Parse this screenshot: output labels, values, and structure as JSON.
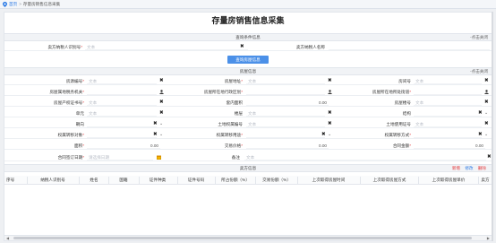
{
  "breadcrumb": {
    "home": "首页",
    "separator": ">",
    "current": "存量房销售信息采集"
  },
  "page_title": "存量房销售信息采集",
  "query_section": {
    "title": "查询条件信息",
    "collapse": "-点击关闭",
    "seller_id_label": "卖方纳税人识别号",
    "seller_id_placeholder": "文本",
    "seller_name_label": "卖方纳税人名称",
    "query_button": "查询房屋信息"
  },
  "house_section": {
    "title": "房屋信息",
    "collapse": "-点击关闭",
    "text_placeholder": "文本",
    "date_placeholder": "请选择日期",
    "rows": [
      [
        {
          "label": "房源编号",
          "required": true,
          "value": "文本",
          "suffix": "x"
        },
        {
          "label": "房屋地址",
          "required": true,
          "value": "文本",
          "suffix": "x"
        },
        {
          "label": "房间号",
          "required": false,
          "value": "文本",
          "suffix": "x"
        }
      ],
      [
        {
          "label": "房屋属地税务机关",
          "required": true,
          "value": "",
          "suffix": "user"
        },
        {
          "label": "房屋所在地行政区划",
          "required": true,
          "value": "",
          "suffix": "user"
        },
        {
          "label": "房屋所在地所处街道",
          "required": true,
          "value": "",
          "suffix": "user"
        }
      ],
      [
        {
          "label": "房屋产权证书号",
          "required": true,
          "value": "文本",
          "suffix": "x"
        },
        {
          "label": "套内面积",
          "required": false,
          "value": "0.00",
          "suffix": "num"
        },
        {
          "label": "房屋楼号",
          "required": false,
          "value": "文本",
          "suffix": "x"
        }
      ],
      [
        {
          "label": "单元",
          "required": false,
          "value": "文本",
          "suffix": "x"
        },
        {
          "label": "楼层",
          "required": false,
          "value": "文本",
          "suffix": "x"
        },
        {
          "label": "结构",
          "required": false,
          "value": "",
          "suffix": "select"
        }
      ],
      [
        {
          "label": "朝向",
          "required": false,
          "value": "",
          "suffix": "select"
        },
        {
          "label": "土地权属编号",
          "required": false,
          "value": "文本",
          "suffix": "x"
        },
        {
          "label": "土地使用证号",
          "required": false,
          "value": "文本",
          "suffix": "x"
        }
      ],
      [
        {
          "label": "权属转移对象",
          "required": true,
          "value": "",
          "suffix": "select"
        },
        {
          "label": "权属转移用途",
          "required": true,
          "value": "",
          "suffix": "select"
        },
        {
          "label": "权属转移方式",
          "required": true,
          "value": "",
          "suffix": "select"
        }
      ],
      [
        {
          "label": "面积",
          "required": true,
          "value": "0.00",
          "suffix": "num"
        },
        {
          "label": "交易价格",
          "required": true,
          "value": "0.00",
          "suffix": "num"
        },
        {
          "label": "合同金额",
          "required": true,
          "value": "0.00",
          "suffix": "num"
        }
      ]
    ],
    "contract_date_label": "合同签订日期",
    "remarks_label": "备注",
    "remarks_placeholder": "文本"
  },
  "seller_section": {
    "title": "卖方信息",
    "add": "新增",
    "edit": "修改",
    "delete": "删除",
    "columns": [
      "序号",
      "纳税人识别号",
      "姓名",
      "国籍",
      "证件种类",
      "证件号码",
      "所占份额（%）",
      "交易份额（%）",
      "上次取得房屋时间",
      "上次取得房屋方式",
      "上次取得房屋单价",
      "卖方"
    ]
  },
  "colors": {
    "accent": "#4b90e8",
    "required": "#e5393b",
    "link": "#2d7be5"
  }
}
